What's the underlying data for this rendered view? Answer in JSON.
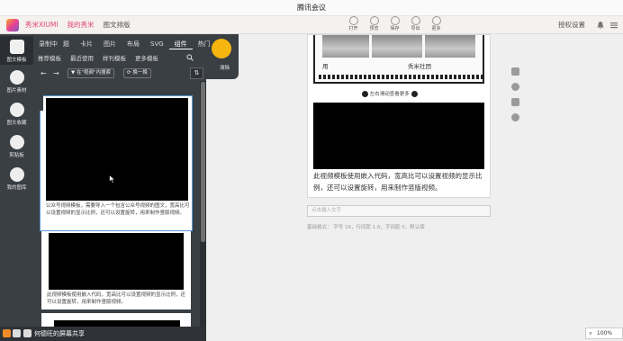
{
  "window": {
    "title": "腾讯会议"
  },
  "topbar": {
    "nav": [
      "秀米XIUMI",
      "我的秀米",
      "图文排版"
    ],
    "auth": "授权设置"
  },
  "toolbar": {
    "items": [
      {
        "label": "打开",
        "icon": "folder-icon"
      },
      {
        "label": "预览",
        "icon": "eye-icon"
      },
      {
        "label": "保存",
        "icon": "save-icon"
      },
      {
        "label": "导出",
        "icon": "export-icon"
      },
      {
        "label": "更多",
        "icon": "more-icon"
      }
    ]
  },
  "rail": {
    "items": [
      {
        "label": "图文模板",
        "icon": "template-icon"
      },
      {
        "label": "图片素材",
        "icon": "image-icon"
      },
      {
        "label": "图文收藏",
        "icon": "favorite-icon"
      },
      {
        "label": "剪贴板",
        "icon": "clipboard-icon"
      },
      {
        "label": "我的图库",
        "icon": "gallery-icon"
      }
    ]
  },
  "panel": {
    "tabs": [
      "录制中",
      "题",
      "卡片",
      "图片",
      "布局",
      "SVG",
      "组件",
      "热门"
    ],
    "active_tab": "组件",
    "subtabs": [
      "推荐模板",
      "最近使用",
      "样刊模板",
      "更多模板"
    ],
    "clear_label": "清除",
    "filter_label": "在\"视频\"内搜索",
    "swap_label": "换一换"
  },
  "templates": [
    {
      "desc": "公众号视频模板，需要导入一个包含公众号视频的图文，宽高比可以设置视频的显示比例，还可以设置旋转，用来制作竖版视频。"
    },
    {
      "desc": "此视频模板使用嵌入代码，宽高比可以设置视频的显示比例，还可以设置旋转，用来制作竖版视频。"
    }
  ],
  "editor": {
    "gallery_caption": "秀米社团",
    "gallery_left": "用",
    "swipe_hint": "左右滑动查看更多",
    "body_text": "此视频模板使用嵌入代码，宽高比可以设置视频的显示比例，还可以设置旋转，用来制作竖版视频。",
    "input_placeholder": "点击输入文字",
    "basic_style": "基础格式：  字号 16，行间距 1.6，字间距 0，默认版"
  },
  "bottom": {
    "share_text": "何德旺的屏幕共享",
    "zoom": "100%"
  },
  "colors": {
    "accent": "#e0457b",
    "dark": "#3a3f44",
    "clear": "#f6b60d"
  }
}
